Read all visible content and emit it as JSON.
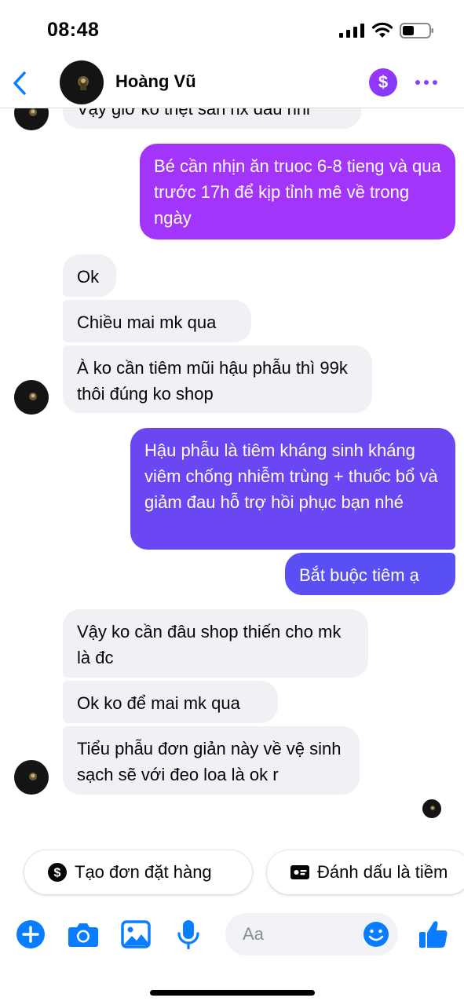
{
  "status_bar": {
    "time": "08:48"
  },
  "header": {
    "contact_name": "Hoàng Vũ"
  },
  "messages": [
    {
      "text": "Vậy giờ ko thệt sản nx đâu nhỉ",
      "dir": "in"
    },
    {
      "text": "Bé cần nhịn ăn truoc 6-8 tieng và qua trước 17h để kịp tỉnh mê về trong ngày",
      "dir": "out"
    },
    {
      "text": "Ok",
      "dir": "in"
    },
    {
      "text": "Chiều mai mk qua",
      "dir": "in"
    },
    {
      "text": "À ko cần tiêm mũi hậu phẫu thì 99k thôi đúng ko shop",
      "dir": "in"
    },
    {
      "text": "Hậu phẫu là tiêm kháng sinh kháng viêm chống nhiễm trùng + thuốc bổ và giảm đau hỗ trợ hồi phục bạn nhé",
      "dir": "out"
    },
    {
      "text": "Bắt buộc tiêm ạ",
      "dir": "out"
    },
    {
      "text": "Vậy ko cần đâu shop thiến cho mk là đc",
      "dir": "in"
    },
    {
      "text": "Ok ko để mai mk qua",
      "dir": "in"
    },
    {
      "text": "Tiểu phẫu đơn giản này về vệ sinh sạch sẽ với đeo loa là ok r",
      "dir": "in"
    }
  ],
  "quick_actions": {
    "create_order": "Tạo đơn đặt hàng",
    "mark_as": "Đánh dấu là tiềm"
  },
  "composer": {
    "placeholder": "Aa"
  },
  "colors": {
    "accent": "#0a7cff",
    "purple": "#8a3ffc",
    "incoming_bubble": "#f0f0f5"
  }
}
